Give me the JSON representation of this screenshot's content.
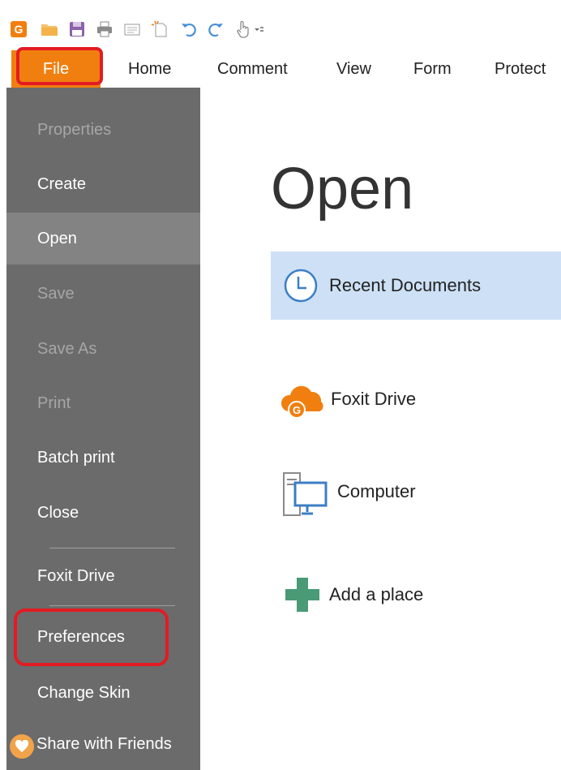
{
  "quick_access_toolbar": {
    "icons": [
      "foxit-logo-icon",
      "open-folder-icon",
      "save-icon",
      "print-icon",
      "email-icon",
      "new-document-icon",
      "undo-icon",
      "redo-icon",
      "hand-tool-icon",
      "customize-toolbar-icon"
    ]
  },
  "ribbon": {
    "tabs": [
      {
        "label": "File"
      },
      {
        "label": "Home"
      },
      {
        "label": "Comment"
      },
      {
        "label": "View"
      },
      {
        "label": "Form"
      },
      {
        "label": "Protect"
      }
    ]
  },
  "sidebar": {
    "items": [
      {
        "label": "Properties",
        "state": "disabled"
      },
      {
        "label": "Create",
        "state": "enabled"
      },
      {
        "label": "Open",
        "state": "selected"
      },
      {
        "label": "Save",
        "state": "disabled"
      },
      {
        "label": "Save As",
        "state": "disabled"
      },
      {
        "label": "Print",
        "state": "disabled"
      },
      {
        "label": "Batch print",
        "state": "enabled"
      },
      {
        "label": "Close",
        "state": "enabled"
      },
      {
        "label": "Foxit Drive",
        "state": "enabled"
      },
      {
        "label": "Preferences",
        "state": "enabled"
      },
      {
        "label": "Change Skin",
        "state": "enabled"
      },
      {
        "label": "Share with Friends",
        "state": "enabled"
      }
    ]
  },
  "main": {
    "title": "Open",
    "places": [
      {
        "label": "Recent Documents",
        "icon": "clock-icon",
        "selected": true
      },
      {
        "label": "Foxit Drive",
        "icon": "cloud-icon",
        "selected": false
      },
      {
        "label": "Computer",
        "icon": "computer-icon",
        "selected": false
      },
      {
        "label": "Add a place",
        "icon": "plus-icon",
        "selected": false
      }
    ]
  },
  "colors": {
    "file_tab": "#f07f10",
    "sidebar_bg": "#6b6b6b",
    "sidebar_selected": "#838383",
    "selected_place_bg": "#cde0f6",
    "highlight_annotation": "#e31b23",
    "plus_icon": "#4a9a76",
    "cloud_icon": "#f07f10"
  }
}
